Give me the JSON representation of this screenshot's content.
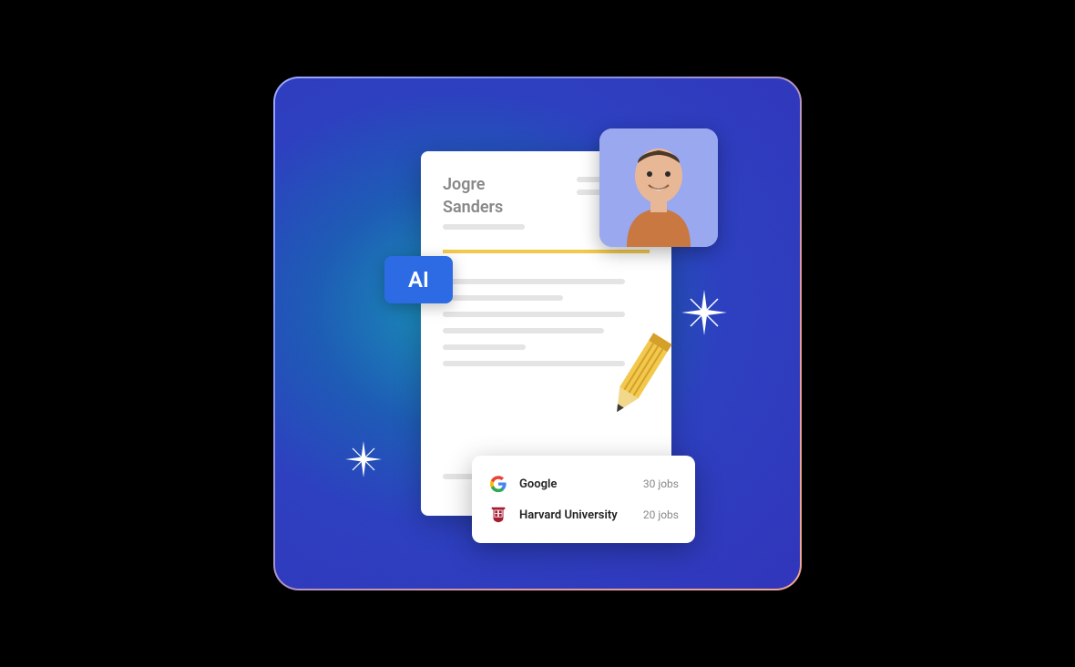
{
  "resume": {
    "first_name": "Jogre",
    "last_name": "Sanders"
  },
  "ai_badge": {
    "label": "AI"
  },
  "jobs": [
    {
      "name": "Google",
      "count": "30 jobs"
    },
    {
      "name": "Harvard University",
      "count": "20 jobs"
    }
  ]
}
